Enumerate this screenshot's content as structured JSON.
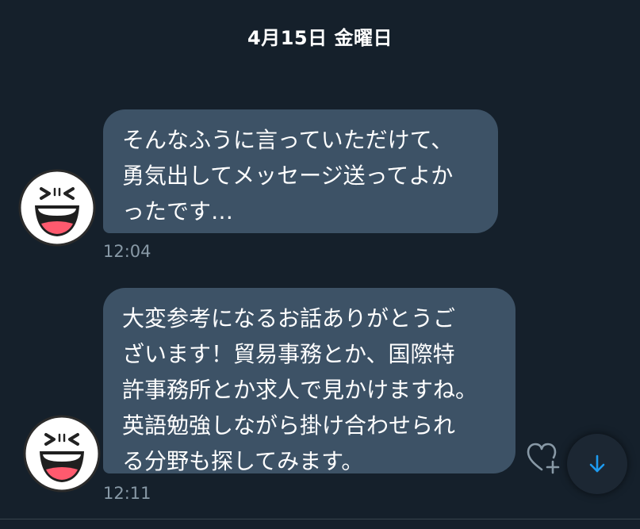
{
  "conversation": {
    "date_header": "4月15日 金曜日",
    "messages": [
      {
        "lines": [
          "そんなふうに言っていただけて、",
          "勇気出してメッセージ送ってよか",
          "ったです…"
        ],
        "time": "12:04",
        "avatar_icon": "laughing-face-icon"
      },
      {
        "lines": [
          "大変参考になるお話ありがとうご",
          "ざいます！貿易事務とか、国際特",
          "許事務所とか求人で見かけますね。",
          "英語勉強しながら掛け合わせられ",
          "る分野も探してみます。"
        ],
        "time": "12:11",
        "avatar_icon": "laughing-face-icon"
      }
    ]
  },
  "actions": {
    "reaction_icon": "heart-add-icon",
    "scroll_icon": "arrow-down-icon"
  },
  "colors": {
    "background": "#15202b",
    "bubble": "#3d5266",
    "timestamp": "#8899a6",
    "accent": "#1d9bf0"
  }
}
